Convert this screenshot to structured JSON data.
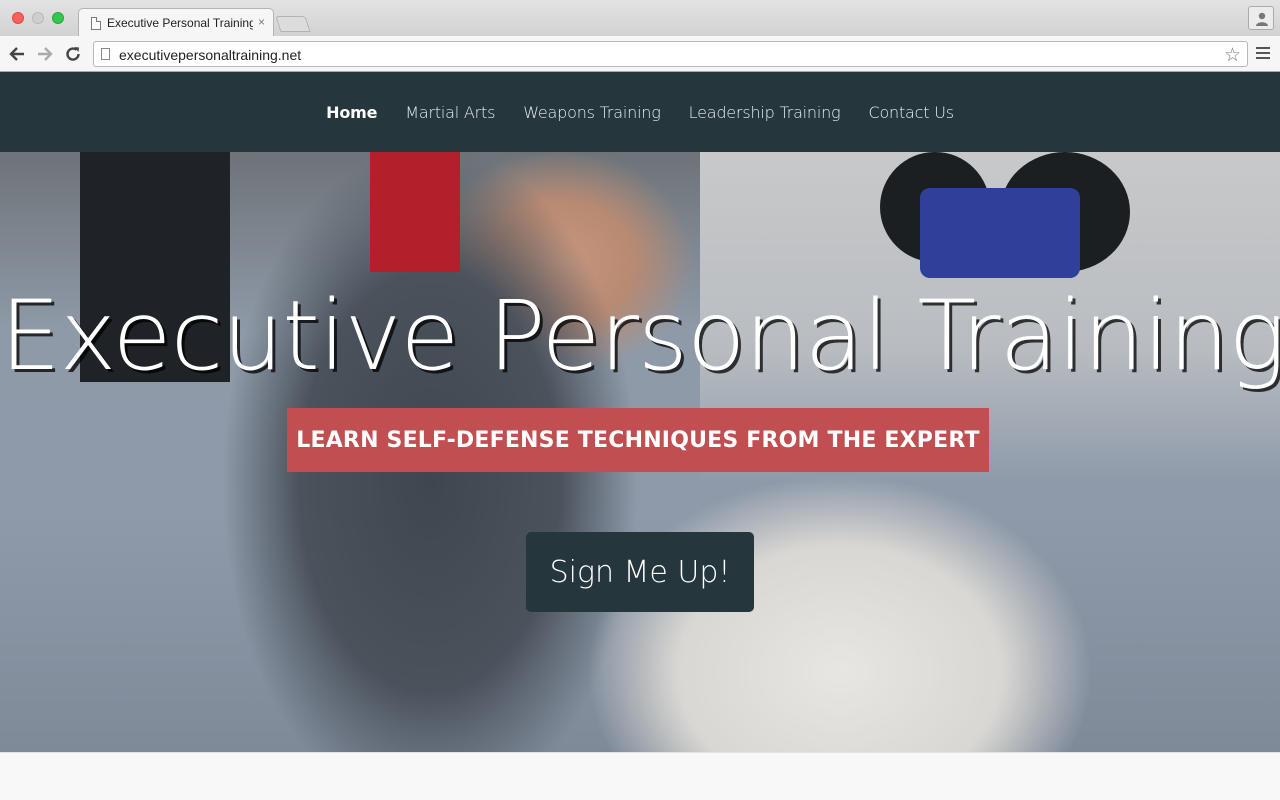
{
  "browser": {
    "tab_title": "Executive Personal Training",
    "tab_close": "×",
    "url": "executivepersonaltraining.net"
  },
  "nav": {
    "items": [
      {
        "label": "Home",
        "active": true
      },
      {
        "label": "Martial Arts"
      },
      {
        "label": "Weapons Training"
      },
      {
        "label": "Leadership Training"
      },
      {
        "label": "Contact Us"
      }
    ]
  },
  "hero": {
    "title": "Executive Personal Training",
    "tagline": "LEARN SELF-DEFENSE TECHNIQUES FROM THE EXPERT",
    "cta_label": "Sign Me Up!"
  },
  "colors": {
    "nav_bg": "#25373d",
    "tagline_bg": "#c14f51",
    "cta_bg": "#25373d"
  }
}
